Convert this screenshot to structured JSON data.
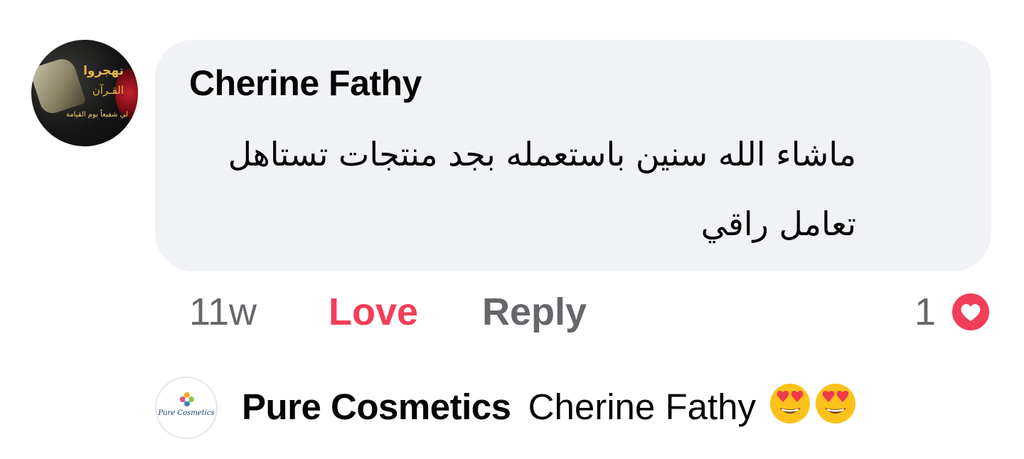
{
  "avatar_main": {
    "line1": "تهجروا",
    "line2": "القـرآن",
    "line3": "لي شفيعاً يوم القيامة"
  },
  "comment": {
    "author": "Cherine Fathy",
    "text": "ماشاء الله سنين باستعمله بجد منتجات تستاهل تعامل راقي"
  },
  "actions": {
    "time": "11w",
    "love_label": "Love",
    "reply_label": "Reply",
    "reaction_count": "1",
    "reaction_icon": "heart-icon"
  },
  "reply": {
    "author": "Pure Cosmetics",
    "mention": "Cherine Fathy",
    "emoji": "heart-eyes-emoji",
    "avatar_logo_text": "Pure Cosmetics"
  },
  "colors": {
    "bubble": "#f0f2f5",
    "love": "#f33e58",
    "secondary_text": "#65676b",
    "primary_text": "#050505"
  }
}
